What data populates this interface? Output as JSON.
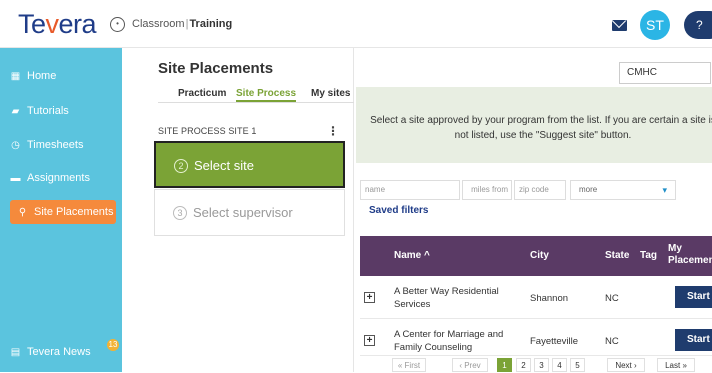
{
  "header": {
    "logo": "Tevera",
    "breadcrumb_parent": "Classroom",
    "breadcrumb_current": "Training",
    "avatar_initials": "ST",
    "help_icon": "?"
  },
  "sidebar": {
    "items": [
      {
        "label": "Home",
        "icon": "home-icon"
      },
      {
        "label": "Tutorials",
        "icon": "tutorials-icon"
      },
      {
        "label": "Timesheets",
        "icon": "timer-icon"
      },
      {
        "label": "Assignments",
        "icon": "folder-icon"
      },
      {
        "label": "Site Placements",
        "icon": "location-pin-icon"
      }
    ],
    "news_label": "Tevera News",
    "news_badge": "13"
  },
  "panel": {
    "title": "Site Placements",
    "tabs": [
      "Practicum",
      "Site Process",
      "My sites"
    ],
    "active_tab": "Site Process",
    "step_header": "SITE PROCESS SITE 1",
    "steps": [
      {
        "num": "2",
        "label": "Select site"
      },
      {
        "num": "3",
        "label": "Select supervisor"
      }
    ]
  },
  "main": {
    "filter_select": "CMHC",
    "hint": "Select a site approved by your program from the list. If you are certain a site is not listed, use the \"Suggest site\" button.",
    "search": {
      "name_placeholder": "name",
      "miles_placeholder": "miles from",
      "zip_placeholder": "zip code",
      "more_label": "more"
    },
    "saved_filters": "Saved filters",
    "table": {
      "columns": [
        "Name ^",
        "City",
        "State",
        "Tag",
        "My Placement"
      ],
      "rows": [
        {
          "name": "A Better Way Residential Services",
          "city": "Shannon",
          "state": "NC",
          "action": "Start"
        },
        {
          "name": "A Center for Marriage and Family Counseling",
          "city": "Fayetteville",
          "state": "NC",
          "action": "Start"
        }
      ]
    },
    "pager": {
      "first": "« First",
      "prev": "‹ Prev",
      "pages": [
        "1",
        "2",
        "3",
        "4",
        "5"
      ],
      "current": "1",
      "next": "Next ›",
      "last": "Last »"
    }
  },
  "colors": {
    "sidebar": "#5bc4de",
    "active_nav": "#f58a3c",
    "brand_green": "#7ba336",
    "table_header": "#5a3a65",
    "button_navy": "#1f3c6e"
  }
}
